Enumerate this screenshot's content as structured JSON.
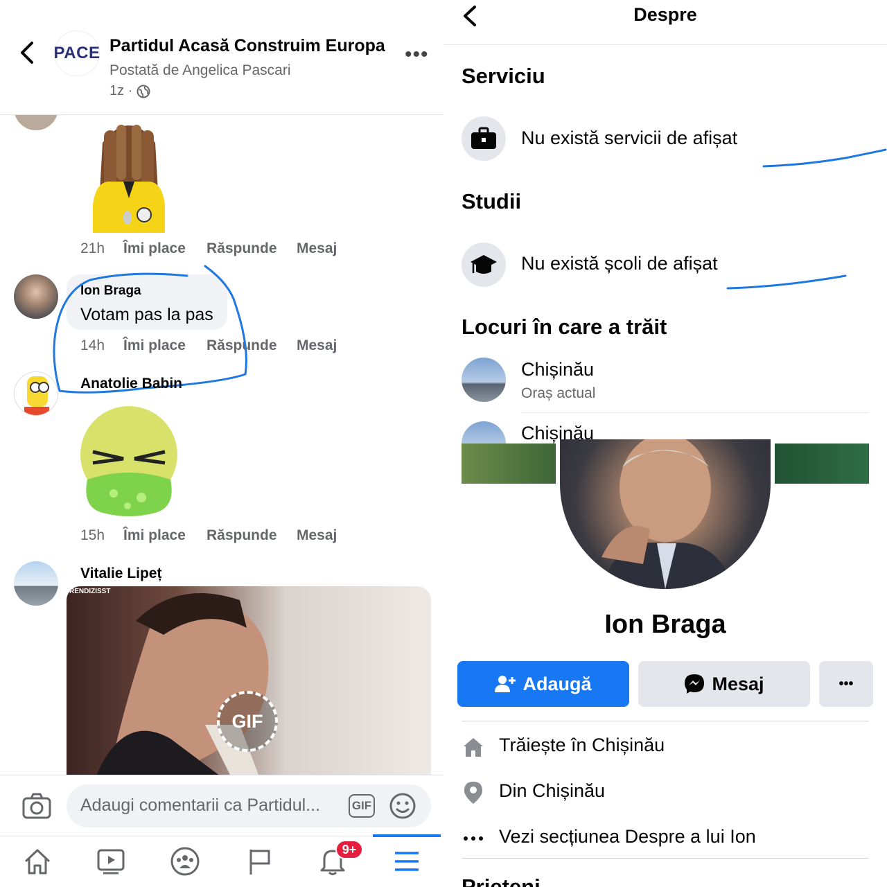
{
  "colors": {
    "accent": "#1877f2",
    "ink_annotation": "#1f77e0",
    "badge": "#e41e3f"
  },
  "left": {
    "header": {
      "logo_text": "PACE",
      "page_name": "Partidul Acasă Construim Europa",
      "posted_by": "Postată de Angelica Pascari",
      "time": "1z ·"
    },
    "comments": [
      {
        "author": "",
        "time": "21h",
        "like": "Îmi place",
        "reply": "Răspunde",
        "message": "Mesaj"
      },
      {
        "author": "Ion Braga",
        "text": "Votam pas la pas",
        "time": "14h",
        "like": "Îmi place",
        "reply": "Răspunde",
        "message": "Mesaj"
      },
      {
        "author": "Anatolie Babin",
        "time": "15h",
        "like": "Îmi place",
        "reply": "Răspunde",
        "message": "Mesaj"
      },
      {
        "author": "Vitalie Lipeț",
        "gif_watermark": "RENDIZISST",
        "gif_badge": "GIF"
      }
    ],
    "composer": {
      "placeholder": "Adaugi comentarii ca Partidul...",
      "gif_label": "GIF"
    },
    "tabbar": {
      "notifications_badge": "9+"
    }
  },
  "right": {
    "title": "Despre",
    "sections": {
      "work": {
        "heading": "Serviciu",
        "text": "Nu există servicii de afișat"
      },
      "education": {
        "heading": "Studii",
        "text": "Nu există școli de afișat"
      },
      "places": {
        "heading": "Locuri în care a trăit",
        "items": [
          {
            "name": "Chișinău",
            "sub": "Oraș actual"
          },
          {
            "name": "Chișinău"
          }
        ]
      }
    },
    "profile": {
      "name": "Ion Braga",
      "add_label": "Adaugă",
      "message_label": "Mesaj",
      "more_label": "•••",
      "details": [
        {
          "text": "Trăiește în Chișinău",
          "icon": "home-icon"
        },
        {
          "text": "Din Chișinău",
          "icon": "location-pin-icon"
        },
        {
          "text": "Vezi secțiunea Despre a lui Ion",
          "icon": "more-dots-icon"
        }
      ],
      "friends_heading": "Prieteni"
    }
  }
}
